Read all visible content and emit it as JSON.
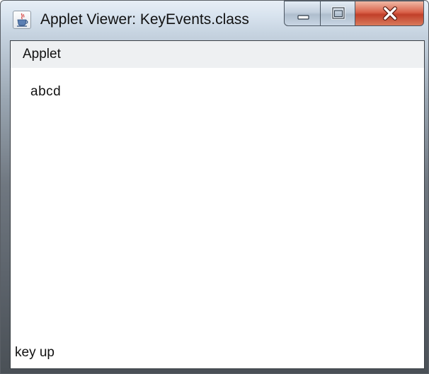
{
  "window": {
    "title": "Applet Viewer: KeyEvents.class",
    "icon": "java-coffee-cup-icon",
    "buttons": {
      "minimize_icon": "minimize-icon",
      "maximize_icon": "maximize-icon",
      "close_icon": "close-icon"
    },
    "colors": {
      "close_button": "#c8432d",
      "caption_button": "#c3d0de"
    }
  },
  "menu": {
    "items": [
      {
        "label": "Applet"
      }
    ]
  },
  "applet": {
    "typed_text": "abcd"
  },
  "status": {
    "text": "key up"
  }
}
